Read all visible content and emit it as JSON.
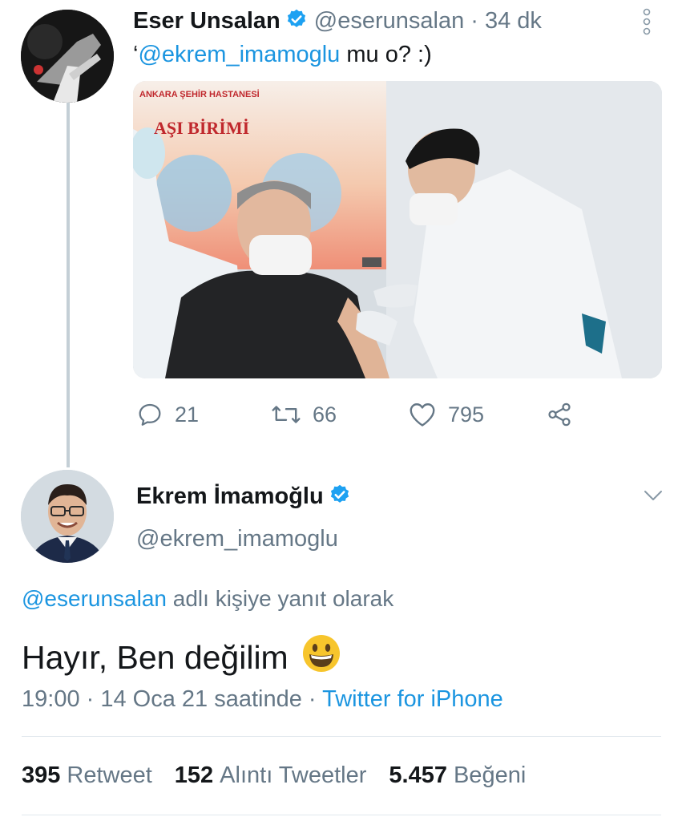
{
  "tweet1": {
    "author_name": "Eser Unsalan",
    "handle_time": "@eserunsalan · 34 dk",
    "text_prefix": "‘",
    "text_mention": "@ekrem_imamoglu",
    "text_rest": " mu o? :)",
    "image": {
      "sign_small": "ANKARA ŞEHİR HASTANESİ",
      "sign_large": "AŞI BİRİMİ"
    },
    "actions": {
      "replies": "21",
      "retweets": "66",
      "likes": "795"
    }
  },
  "tweet2": {
    "author_name": "Ekrem İmamoğlu",
    "handle": "@ekrem_imamoglu",
    "reply_mention": "@eserunsalan",
    "reply_rest": " adlı kişiye yanıt olarak",
    "text": "Hayır, Ben değilim",
    "time_date": "19:00 · 14 Oca 21 saatinde · ",
    "source": "Twitter for iPhone",
    "stats": {
      "retweets_count": "395",
      "retweets_label": "Retweet",
      "quotes_count": "152",
      "quotes_label": "Alıntı Tweetler",
      "likes_count": "5.457",
      "likes_label": "Beğeni"
    }
  },
  "colors": {
    "link": "#1b95e0",
    "secondary_text": "#657786",
    "verified": "#1da1f2",
    "divider": "#e1e8ed"
  }
}
